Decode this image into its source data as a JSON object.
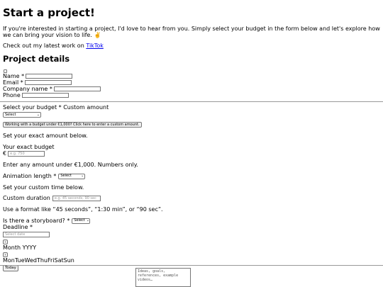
{
  "page": {
    "title": "Start a project!",
    "intro": "If you're interested in starting a project, I'd love to hear from you. Simply select your budget in the form below and let's explore how we can bring your vision to life.",
    "intro_emoji": "✌️",
    "latest_prefix": "Check out my latest work on ",
    "latest_link": "TikTok"
  },
  "form": {
    "section_title": "Project details",
    "name_label": "Name *",
    "email_label": "Email *",
    "company_label": "Company name *",
    "phone_label": "Phone",
    "budget_label": "Select your budget * Custom amount",
    "budget_select": "Select",
    "budget_button": "Working with a budget under €1,000? Click here to enter a custom amount.",
    "exact_amount_heading": "Set your exact amount below.",
    "exact_budget_label": "Your exact budget",
    "currency_symbol": "€",
    "exact_budget_placeholder": "e.g. 750",
    "exact_budget_hint": "Enter any amount under €1,000. Numbers only.",
    "animation_length_label": "Animation length *",
    "animation_length_select": "Select",
    "custom_time_heading": "Set your custom time below.",
    "custom_duration_label": "Custom duration",
    "custom_duration_placeholder": "e.g. 45 seconds, 90 sec",
    "format_hint": "Use a format like “45 seconds”, “1:30 min”, or “90 sec”.",
    "storyboard_label": "Is there a storyboard? *",
    "storyboard_select": "Select",
    "deadline_label": "Deadline *",
    "deadline_placeholder": "Select date",
    "calendar_prev": "‹",
    "calendar_month": "Month YYYY",
    "calendar_next": "›",
    "calendar_days": "MonTueWedThuFriSatSun",
    "today_button": "Today",
    "ideas_placeholder": "Ideas, goals, references, example videos…"
  }
}
